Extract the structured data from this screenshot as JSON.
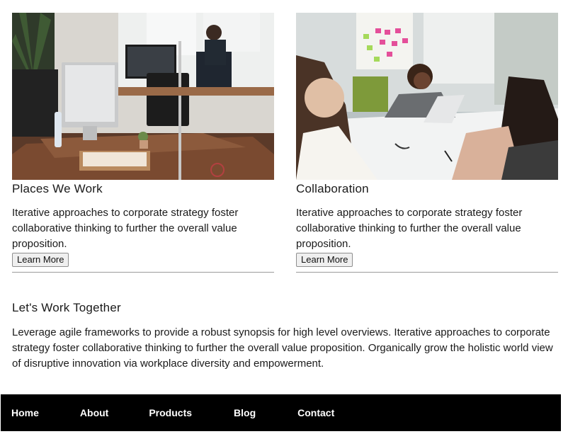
{
  "cards": [
    {
      "image": "office-workspace-photo",
      "title": "Places We Work",
      "text": "Iterative approaches to corporate strategy foster collaborative thinking to further the overall value proposition.",
      "button": "Learn More"
    },
    {
      "image": "team-meeting-photo",
      "title": "Collaboration",
      "text": "Iterative approaches to corporate strategy foster collaborative thinking to further the overall value proposition.",
      "button": "Learn More"
    }
  ],
  "together": {
    "heading": "Let's Work Together",
    "text": "Leverage agile frameworks to provide a robust synopsis for high level overviews. Iterative approaches to corporate strategy foster collaborative thinking to further the overall value proposition. Organically grow the holistic world view of disruptive innovation via workplace diversity and empowerment."
  },
  "footer": {
    "nav": [
      "Home",
      "About",
      "Products",
      "Blog",
      "Contact"
    ],
    "background": "#000000",
    "text_color": "#ffffff"
  }
}
